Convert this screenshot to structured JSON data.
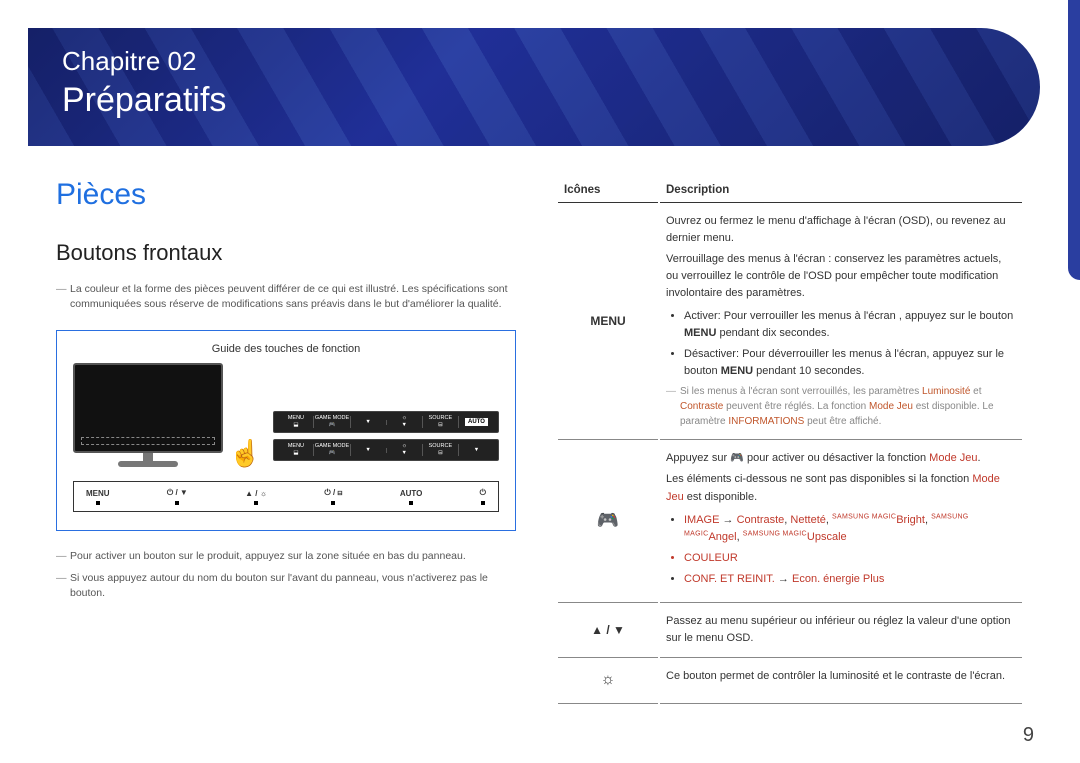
{
  "banner": {
    "chapter": "Chapitre 02",
    "title": "Préparatifs"
  },
  "left": {
    "section": "Pièces",
    "subsection": "Boutons frontaux",
    "note1": "La couleur et la forme des pièces peuvent différer de ce qui est illustré. Les spécifications sont communiquées sous réserve de modifications sans préavis dans le but d'améliorer la qualité.",
    "diagram_caption": "Guide des touches de fonction",
    "osd": {
      "menu": "MENU",
      "game": "GAME MODE",
      "source": "SOURCE",
      "auto": "AUTO"
    },
    "button_labels": [
      "MENU",
      "⏻ / ▼",
      "▲ / ☼",
      "⏻ / ⊟",
      "AUTO",
      "⏻"
    ],
    "note2": "Pour activer un bouton sur le produit, appuyez sur la zone située en bas du panneau.",
    "note3": "Si vous appuyez autour du nom du bouton sur l'avant du panneau, vous n'activerez pas le bouton."
  },
  "table": {
    "header_icons": "Icônes",
    "header_desc": "Description",
    "rows": [
      {
        "icon": "MENU",
        "desc": {
          "p1": "Ouvrez ou fermez le menu d'affichage à l'écran (OSD), ou revenez au dernier menu.",
          "p2": "Verrouillage des menus à l'écran : conservez les paramètres actuels, ou verrouillez le contrôle de l'OSD pour empêcher toute modification involontaire des paramètres.",
          "b1a": "Activer: Pour verrouiller les menus à l'écran , appuyez sur le bouton ",
          "b1b": "MENU",
          "b1c": " pendant dix secondes.",
          "b2a": "Désactiver: Pour déverrouiller les menus à l'écran, appuyez sur le bouton ",
          "b2b": "MENU",
          "b2c": " pendant 10 secondes.",
          "foot_a": "Si les menus à l'écran sont verrouillés, les paramètres ",
          "foot_lum": "Luminosité",
          "foot_and": " et ",
          "foot_con": "Contraste",
          "foot_b": " peuvent être réglés. La fonction ",
          "foot_mj": "Mode Jeu",
          "foot_c": " est disponible. Le paramètre ",
          "foot_info": "INFORMATIONS",
          "foot_d": " peut être affiché."
        }
      },
      {
        "icon": "🎮",
        "desc": {
          "p1a": "Appuyez sur 🎮 pour activer ou désactiver la fonction ",
          "p1b": "Mode Jeu",
          "p1c": ".",
          "p2a": "Les éléments ci-dessous ne sont pas disponibles si la fonction ",
          "p2b": "Mode Jeu",
          "p2c": " est disponible.",
          "li1a": "IMAGE",
          "li1b": " → ",
          "li1c": "Contraste",
          "li1d": ", ",
          "li1e": "Netteté",
          "li1f": ", ",
          "li1_bright": "Bright",
          "li1g": ", ",
          "li1_angel": "Angel",
          "li1h": ", ",
          "li1_upscale": "Upscale",
          "li2": "COULEUR",
          "li3a": "CONF. ET REINIT.",
          "li3b": " → ",
          "li3c": "Econ. énergie Plus"
        }
      },
      {
        "icon": "▲ / ▼",
        "desc": "Passez au menu supérieur ou inférieur ou réglez la valeur d'une option sur le menu OSD."
      },
      {
        "icon": "☼",
        "desc": "Ce bouton permet de contrôler la luminosité et le contraste de l'écran."
      }
    ]
  },
  "page_number": "9"
}
